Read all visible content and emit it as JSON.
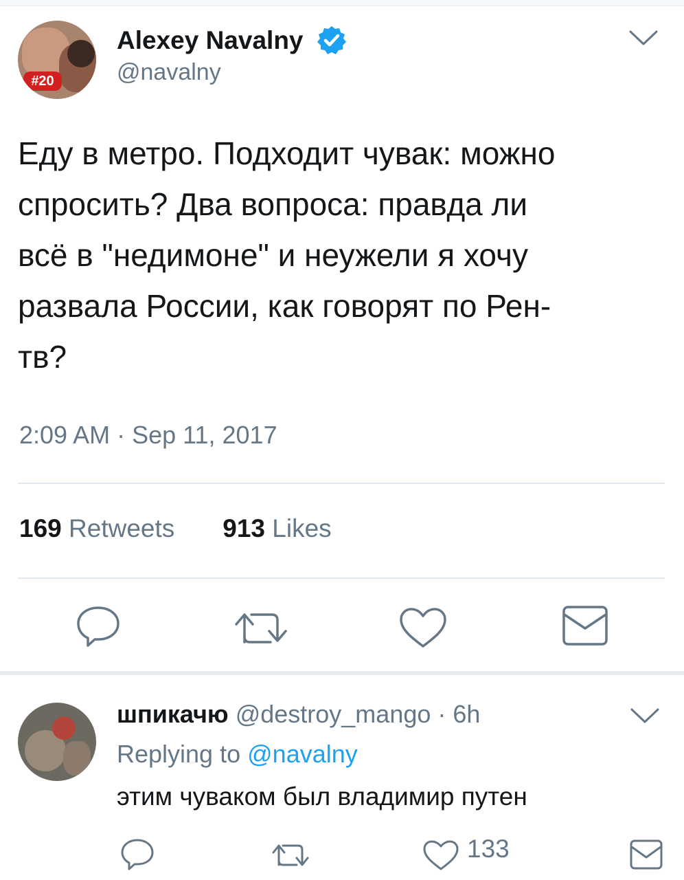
{
  "tweet": {
    "author_name": "Alexey Navalny",
    "author_handle": "@navalny",
    "avatar_badge": "#20",
    "text": "Еду в метро. Подходит чувак: можно\nспросить? Два вопроса: правда ли\nвсё в \"недимоне\" и неужели я хочу\nразвала России, как говорят по Рен-\nтв?",
    "timestamp": "2:09 AM · Sep 11, 2017",
    "retweets_count": "169",
    "retweets_label": "Retweets",
    "likes_count": "913",
    "likes_label": "Likes"
  },
  "reply": {
    "author_name": "шпикачю",
    "author_handle": "@destroy_mango",
    "time": "· 6h",
    "replying_to_label": "Replying to",
    "replying_to_handle": "@navalny",
    "text": "этим чуваком был владимир путен",
    "likes_count": "133"
  },
  "colors": {
    "accent": "#1da1f2",
    "text": "#14171a",
    "secondary": "#657786",
    "divider": "#e1e8ed",
    "icon": "#657786"
  },
  "icons": {
    "verified": "verified-badge-icon",
    "caret": "chevron-down-icon",
    "reply": "reply-icon",
    "retweet": "retweet-icon",
    "like": "heart-icon",
    "share": "envelope-icon"
  }
}
